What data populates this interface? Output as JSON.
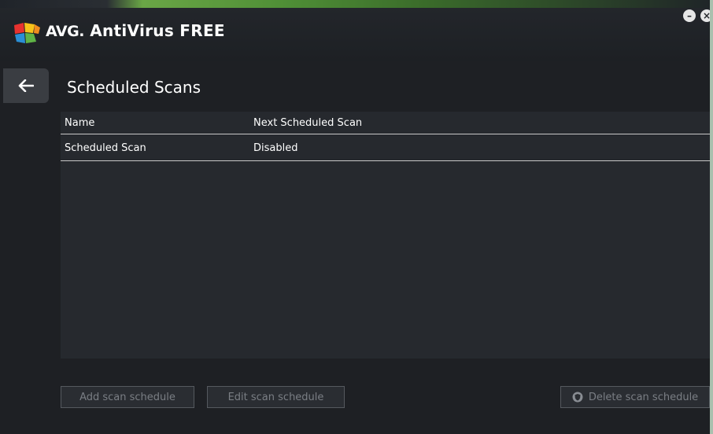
{
  "app": {
    "logo_text": "AVG.",
    "product_name": "AntiVirus FREE",
    "minimize_glyph": "–",
    "close_glyph": "×"
  },
  "page": {
    "title": "Scheduled Scans",
    "back_icon": "arrow-left-icon"
  },
  "table": {
    "columns": [
      "Name",
      "Next Scheduled Scan"
    ],
    "rows": [
      {
        "name": "Scheduled Scan",
        "next": "Disabled"
      }
    ]
  },
  "buttons": {
    "add": "Add scan schedule",
    "edit": "Edit scan schedule",
    "delete": "Delete scan schedule",
    "delete_icon": "shield-icon"
  },
  "colors": {
    "background": "#1e2024",
    "panel": "#26292e",
    "accent_green": "#6aa646",
    "text": "#ffffff",
    "disabled_text": "#7a7e84"
  }
}
